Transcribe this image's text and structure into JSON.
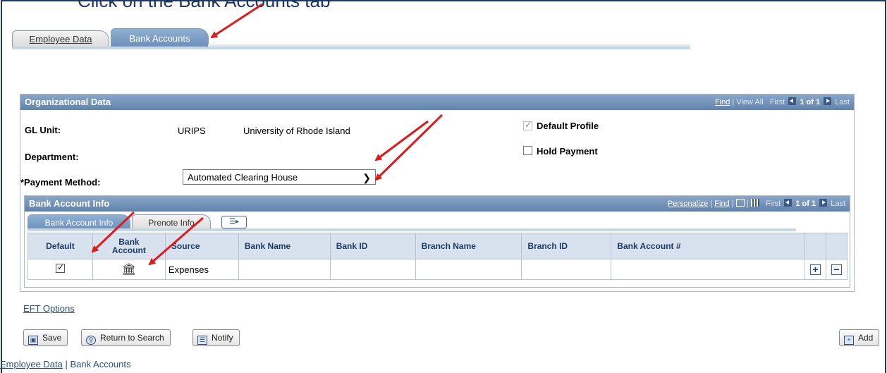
{
  "top_text": "Click on the Bank Accounts tab",
  "tabs": [
    {
      "label": "Employee Data",
      "active": false
    },
    {
      "label": "Bank Accounts",
      "active": true
    }
  ],
  "org": {
    "title": "Organizational Data",
    "nav": {
      "find": "Find",
      "view_all": "View All",
      "first": "First",
      "count": "1 of 1",
      "last": "Last"
    },
    "gl_unit_label": "GL Unit:",
    "gl_unit_code": "URIPS",
    "gl_unit_name": "University of Rhode Island",
    "department_label": "Department:",
    "payment_method_label": "*Payment Method:",
    "payment_method_value": "Automated Clearing House",
    "default_profile_label": "Default Profile",
    "hold_payment_label": "Hold Payment"
  },
  "bank": {
    "title": "Bank Account Info",
    "nav": {
      "personalize": "Personalize",
      "find": "Find",
      "first": "First",
      "count": "1 of 1",
      "last": "Last"
    },
    "subtabs": [
      "Bank Account Info",
      "Prenote Info"
    ],
    "columns": [
      "Default",
      "Bank Account",
      "Source",
      "Bank Name",
      "Bank ID",
      "Branch Name",
      "Branch ID",
      "Bank Account #"
    ],
    "rows": [
      {
        "default": true,
        "source": "Expenses",
        "bank_name": "",
        "bank_id": "",
        "branch_name": "",
        "branch_id": "",
        "account_no": ""
      }
    ]
  },
  "eft_options": "EFT Options",
  "buttons": {
    "save": "Save",
    "return": "Return to Search",
    "notify": "Notify",
    "add": "Add"
  },
  "footer": {
    "link1": "Employee Data",
    "sep": " | ",
    "link2": "Bank Accounts"
  },
  "colors": {
    "header_blue": "#6c8fb9",
    "annotation_red": "#e01a1a",
    "link_blue": "#2a4f86"
  }
}
